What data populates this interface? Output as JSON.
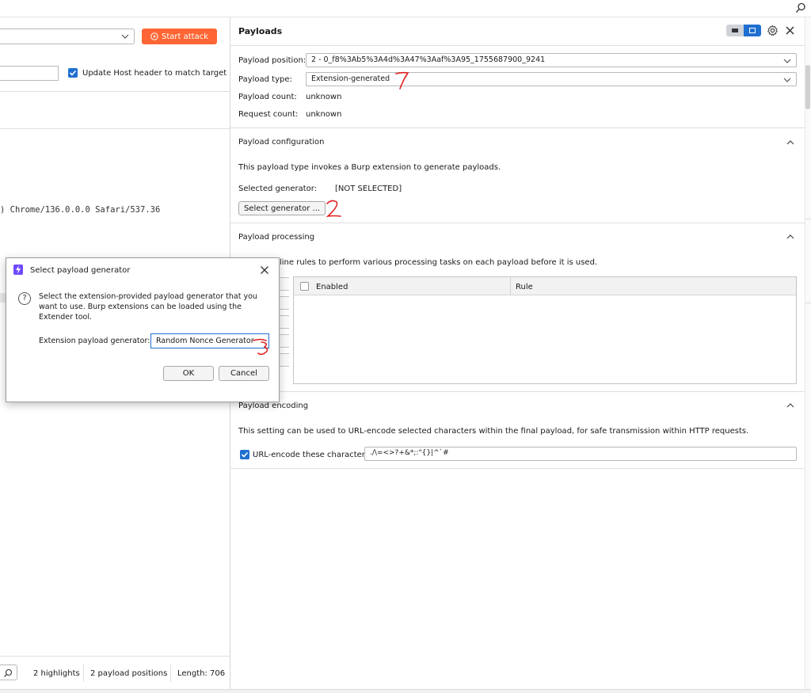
{
  "left": {
    "start_attack_label": "Start attack",
    "update_host_label": "Update Host header to match target",
    "code_fragment": ") Chrome/136.0.0.0 Safari/537.36",
    "status": {
      "highlights": "2 highlights",
      "payload_positions": "2 payload positions",
      "length": "Length: 706"
    }
  },
  "payloads": {
    "title": "Payloads",
    "position_label": "Payload position:",
    "position_value": "2 - 0_f8%3Ab5%3A4d%3A47%3Aaf%3A95_1755687900_9241",
    "type_label": "Payload type:",
    "type_value": "Extension-generated",
    "count_label": "Payload count:",
    "count_value": "unknown",
    "request_label": "Request count:",
    "request_value": "unknown"
  },
  "config": {
    "title": "Payload configuration",
    "description": "This payload type invokes a Burp extension to generate payloads.",
    "selected_label": "Selected generator:",
    "selected_value": "[NOT SELECTED]",
    "select_button": "Select generator ..."
  },
  "processing": {
    "title": "Payload processing",
    "description_visible": "line rules to perform various processing tasks on each payload before it is used.",
    "col_enabled": "Enabled",
    "col_rule": "Rule"
  },
  "encoding": {
    "title": "Payload encoding",
    "description": "This setting can be used to URL-encode selected characters within the final payload, for safe transmission within HTTP requests.",
    "url_encode_label": "URL-encode these characters:",
    "url_encode_value": "./\\=<>?+&*;:\"{}|^`#"
  },
  "dialog": {
    "title": "Select payload generator",
    "message": "Select the extension-provided payload generator that you want to use. Burp extensions can be loaded using the Extender tool.",
    "generator_label": "Extension payload generator:",
    "generator_value": "Random Nonce Generator",
    "ok": "OK",
    "cancel": "Cancel"
  },
  "colors": {
    "accent": "#ff6633",
    "check_blue": "#1f6fd1",
    "annotation_red": "#e02020",
    "extension_icon": "#6d4aff"
  }
}
